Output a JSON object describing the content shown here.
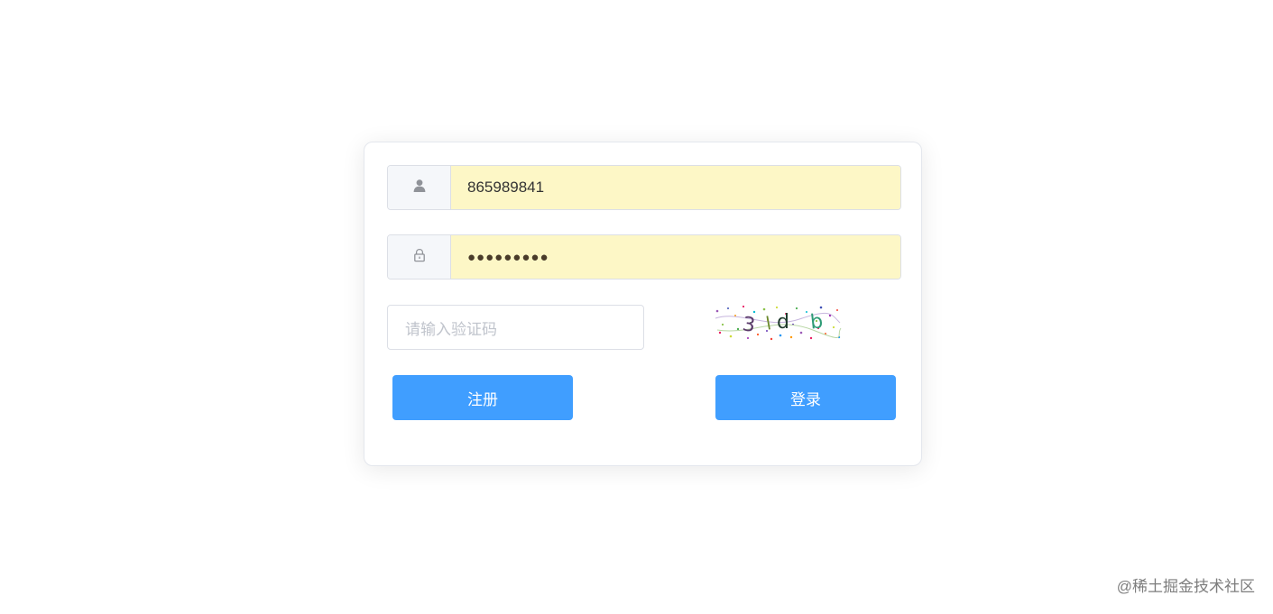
{
  "login_form": {
    "username": {
      "icon": "user-icon",
      "value": "865989841"
    },
    "password": {
      "icon": "lock-icon",
      "value": "●●●●●●●●●"
    },
    "captcha": {
      "placeholder": "请输入验证码",
      "image_text": "3 ld b"
    },
    "register_label": "注册",
    "login_label": "登录"
  },
  "watermark": "@稀土掘金技术社区",
  "colors": {
    "primary": "#409eff",
    "autofill": "#fdf7c6",
    "border": "#dcdfe6",
    "prepend_bg": "#f5f7fa"
  }
}
